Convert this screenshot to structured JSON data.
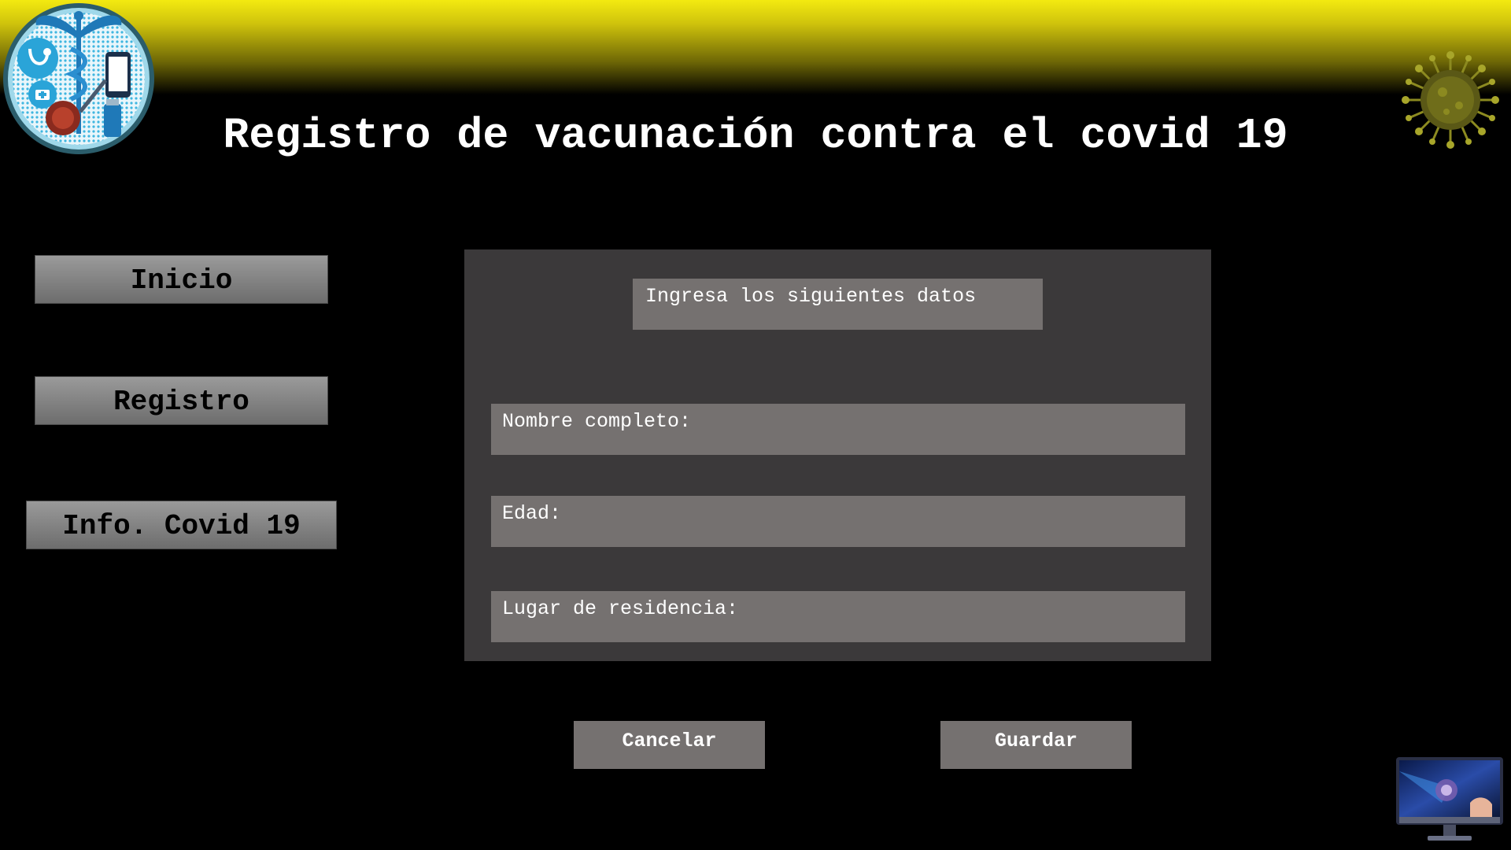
{
  "header": {
    "title": "Registro de vacunación contra el covid 19",
    "logo_icon": "medical-caduceus-logo",
    "virus_icon": "coronavirus-icon",
    "colors": {
      "band_top": "#f3ea10",
      "band_bottom": "#000000",
      "title_text": "#ffffff"
    }
  },
  "sidebar": {
    "items": [
      {
        "label": "Inicio"
      },
      {
        "label": "Registro"
      },
      {
        "label": "Info. Covid 19"
      }
    ]
  },
  "form": {
    "heading": "Ingresa los siguientes datos",
    "fields": [
      {
        "label": "Nombre completo:",
        "value": ""
      },
      {
        "label": "Edad:",
        "value": ""
      },
      {
        "label": "Lugar de residencia:",
        "value": ""
      }
    ],
    "colors": {
      "panel": "#3b393a",
      "field": "#757170"
    }
  },
  "actions": {
    "cancel_label": "Cancelar",
    "save_label": "Guardar"
  },
  "footer": {
    "monitor_icon": "monitor-icon"
  }
}
